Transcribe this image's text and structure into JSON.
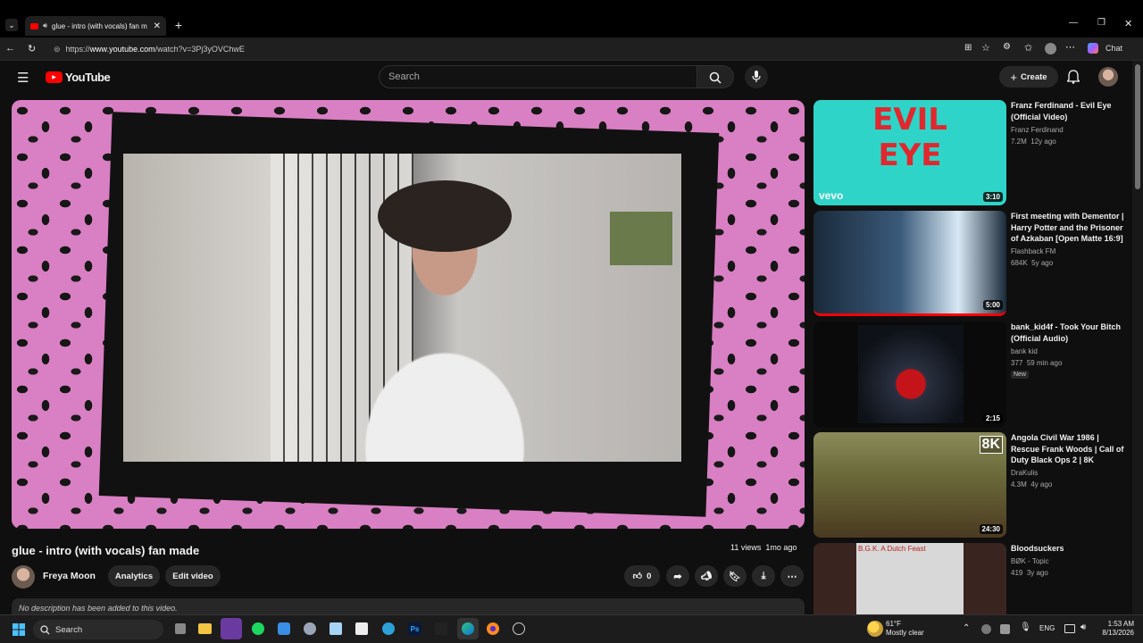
{
  "browser": {
    "tab_title": "glue - intro (with vocals) fan m",
    "url_prefix": "https://",
    "url_host": "www.youtube.com",
    "url_path": "/watch?v=3Pj3yOVChwE",
    "chat_label": "Chat"
  },
  "header": {
    "logo_text": "YouTube",
    "search_placeholder": "Search",
    "create_label": "Create"
  },
  "video": {
    "title": "glue - intro (with vocals) fan made",
    "views": "11 views",
    "age": "1mo ago",
    "channel": "Freya Moon",
    "analytics_label": "Analytics",
    "edit_label": "Edit video",
    "likes": "0",
    "description": "No description has been added to this video."
  },
  "sidebar": [
    {
      "title": "Franz Ferdinand - Evil Eye (Official Video)",
      "channel": "Franz Ferdinand",
      "views": "7.2M",
      "age": "12y ago",
      "duration": "3:10",
      "thumb_text": "EVIL EYE",
      "thumb_brand": "vevo"
    },
    {
      "title": "First meeting with Dementor | Harry Potter and the Prisoner of Azkaban [Open Matte 16:9]",
      "channel": "Flashback FM",
      "views": "684K",
      "age": "5y ago",
      "duration": "5:00"
    },
    {
      "title": "bank_kid4f - Took Your Bitch (Official Audio)",
      "channel": "bank kid",
      "views": "377",
      "age": "59 min ago",
      "duration": "2:15",
      "badge": "New"
    },
    {
      "title": "Angola Civil War 1986 | Rescue Frank Woods | Call of Duty Black Ops 2 | 8K",
      "channel": "DraKulis",
      "views": "4.3M",
      "age": "4y ago",
      "duration": "24:30",
      "thumb_badge": "8K"
    },
    {
      "title": "Bloodsuckers",
      "channel": "BØK - Topic",
      "views": "419",
      "age": "3y ago",
      "thumb_text": "B.G.K. A Dutch Feast"
    }
  ],
  "taskbar": {
    "search_label": "Search",
    "weather_temp": "61°F",
    "weather_desc": "Mostly clear",
    "lang": "ENG",
    "time": "1:53 AM",
    "date": "8/13/2026"
  },
  "colors": {
    "youtube_red": "#ff0000",
    "accent_blue": "#3ea6ff"
  }
}
